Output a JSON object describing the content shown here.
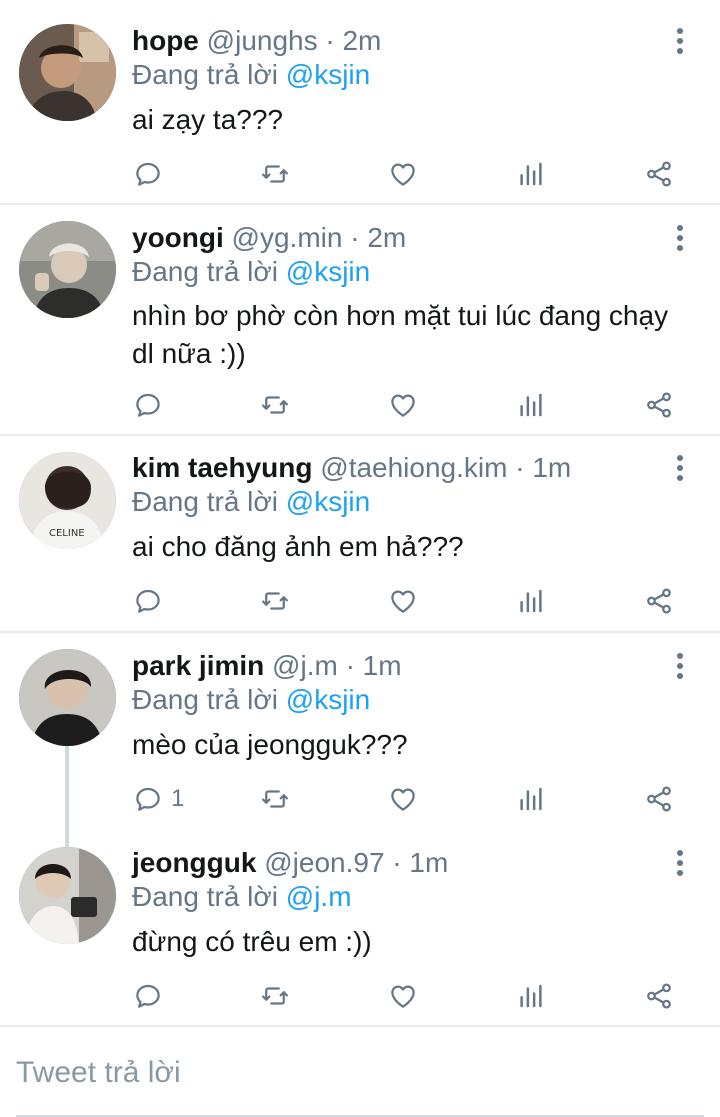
{
  "reply_prefix": "Đang trả lời",
  "tweets": [
    {
      "name": "hope",
      "meta": "@junghs · 2m",
      "reply_handle": "@ksjin",
      "text": "ai zạy ta???",
      "reply_count": ""
    },
    {
      "name": "yoongi",
      "meta": "@yg.min · 2m",
      "reply_handle": "@ksjin",
      "text": "nhìn bơ phờ còn hơn mặt tui lúc đang chạy dl nữa :))",
      "reply_count": ""
    },
    {
      "name": "kim taehyung",
      "meta": "@taehiong.kim · 1m",
      "reply_handle": "@ksjin",
      "text": "ai cho đăng ảnh em hả???",
      "reply_count": ""
    },
    {
      "name": "park jimin",
      "meta": "@j.m · 1m",
      "reply_handle": "@ksjin",
      "text": "mèo của jeongguk???",
      "reply_count": "1"
    },
    {
      "name": "jeongguk",
      "meta": "@jeon.97 · 1m",
      "reply_handle": "@j.m",
      "text": "đừng có trêu em :))",
      "reply_count": ""
    }
  ],
  "composer": {
    "placeholder": "Tweet trả lời"
  },
  "icons": {
    "reply": "reply-icon",
    "retweet": "retweet-icon",
    "like": "heart-icon",
    "stats": "analytics-icon",
    "share": "share-icon",
    "more": "more-vertical-icon"
  },
  "colors": {
    "link": "#1da1f2",
    "muted": "#657786",
    "text": "#14171a",
    "divider": "#e6ecf0"
  }
}
